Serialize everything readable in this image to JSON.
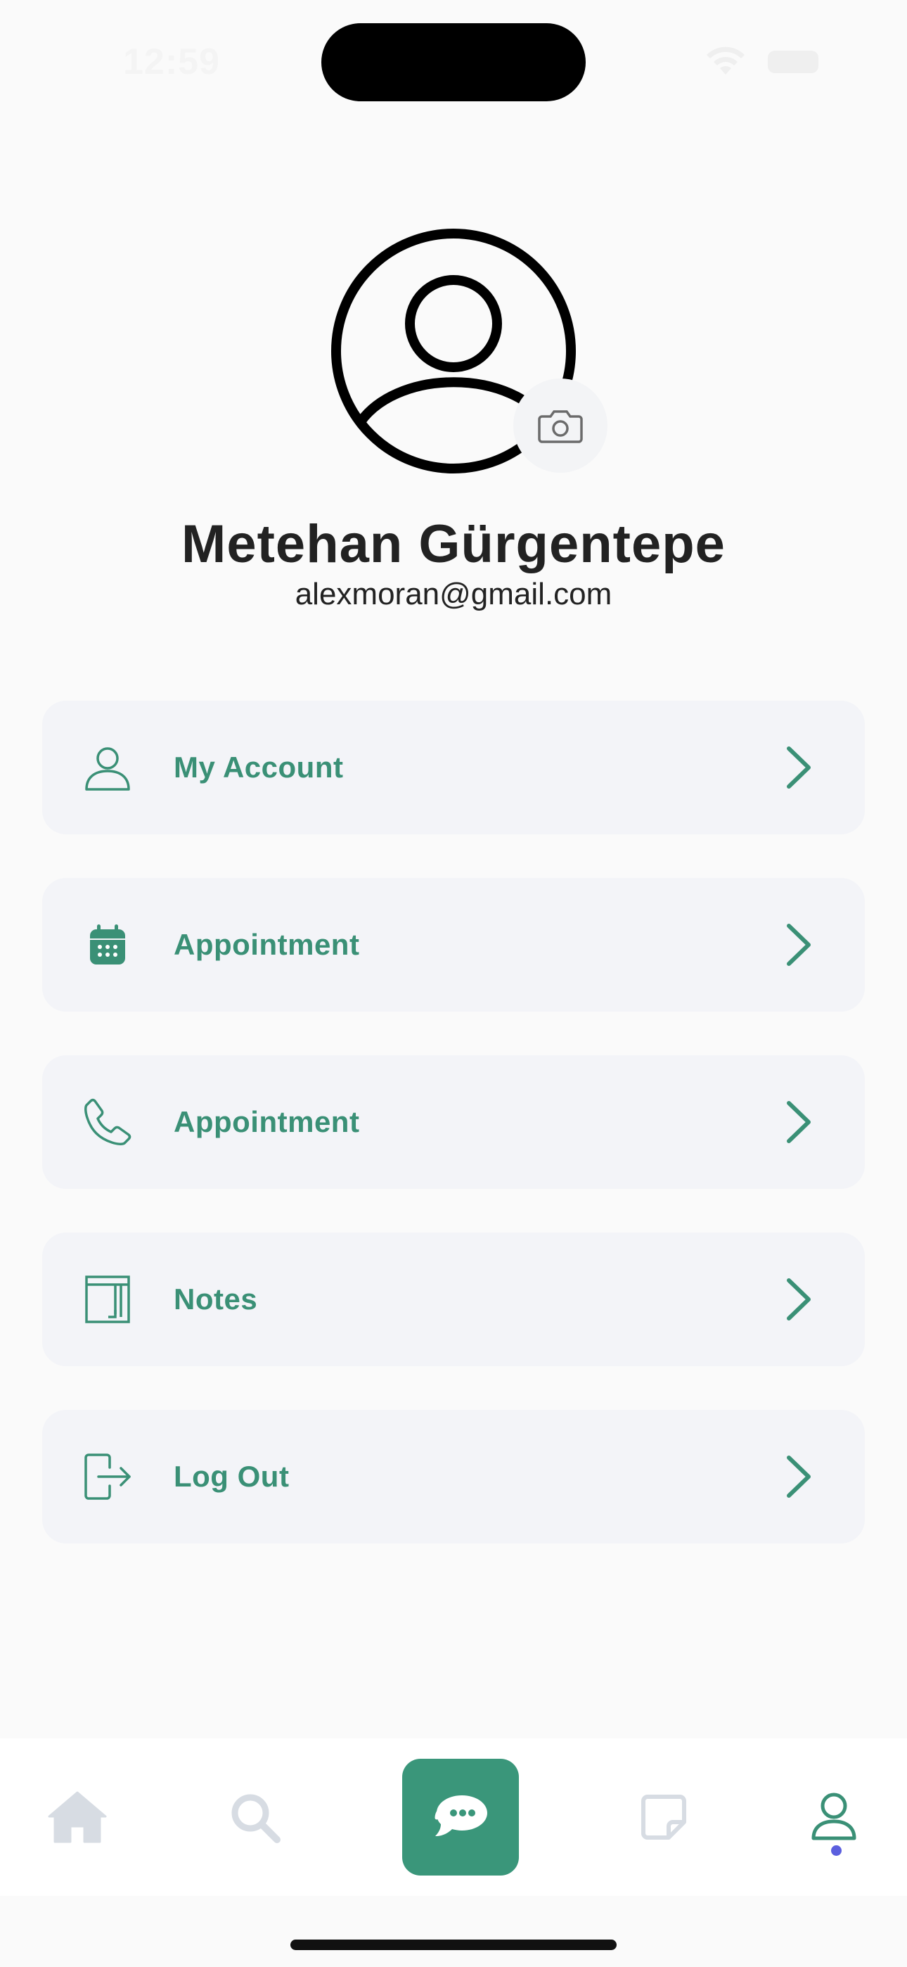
{
  "status_bar": {
    "time": "12:59",
    "wifi_icon": "wifi-icon",
    "battery_icon": "battery-icon"
  },
  "profile": {
    "avatar_icon": "user-circle-icon",
    "camera_icon": "camera-icon",
    "name": "Metehan Gürgentepe",
    "email": "alexmoran@gmail.com"
  },
  "menu": {
    "items": [
      {
        "label": "My Account",
        "icon": "user-icon"
      },
      {
        "label": "Appointment",
        "icon": "calendar-icon"
      },
      {
        "label": "Appointment",
        "icon": "phone-icon"
      },
      {
        "label": "Notes",
        "icon": "notes-icon"
      },
      {
        "label": "Log Out",
        "icon": "logout-icon"
      }
    ],
    "chevron_icon": "chevron-right-icon"
  },
  "tab_bar": {
    "items": [
      "home-icon",
      "search-icon",
      "chat-icon",
      "note-icon",
      "profile-icon"
    ],
    "active": "profile-icon"
  },
  "colors": {
    "accent": "#3a9076",
    "accent_button": "#3a967a",
    "menu_bg": "#f3f4f8",
    "inactive_icon": "#d7dce3",
    "active_dot": "#5b5fde"
  }
}
